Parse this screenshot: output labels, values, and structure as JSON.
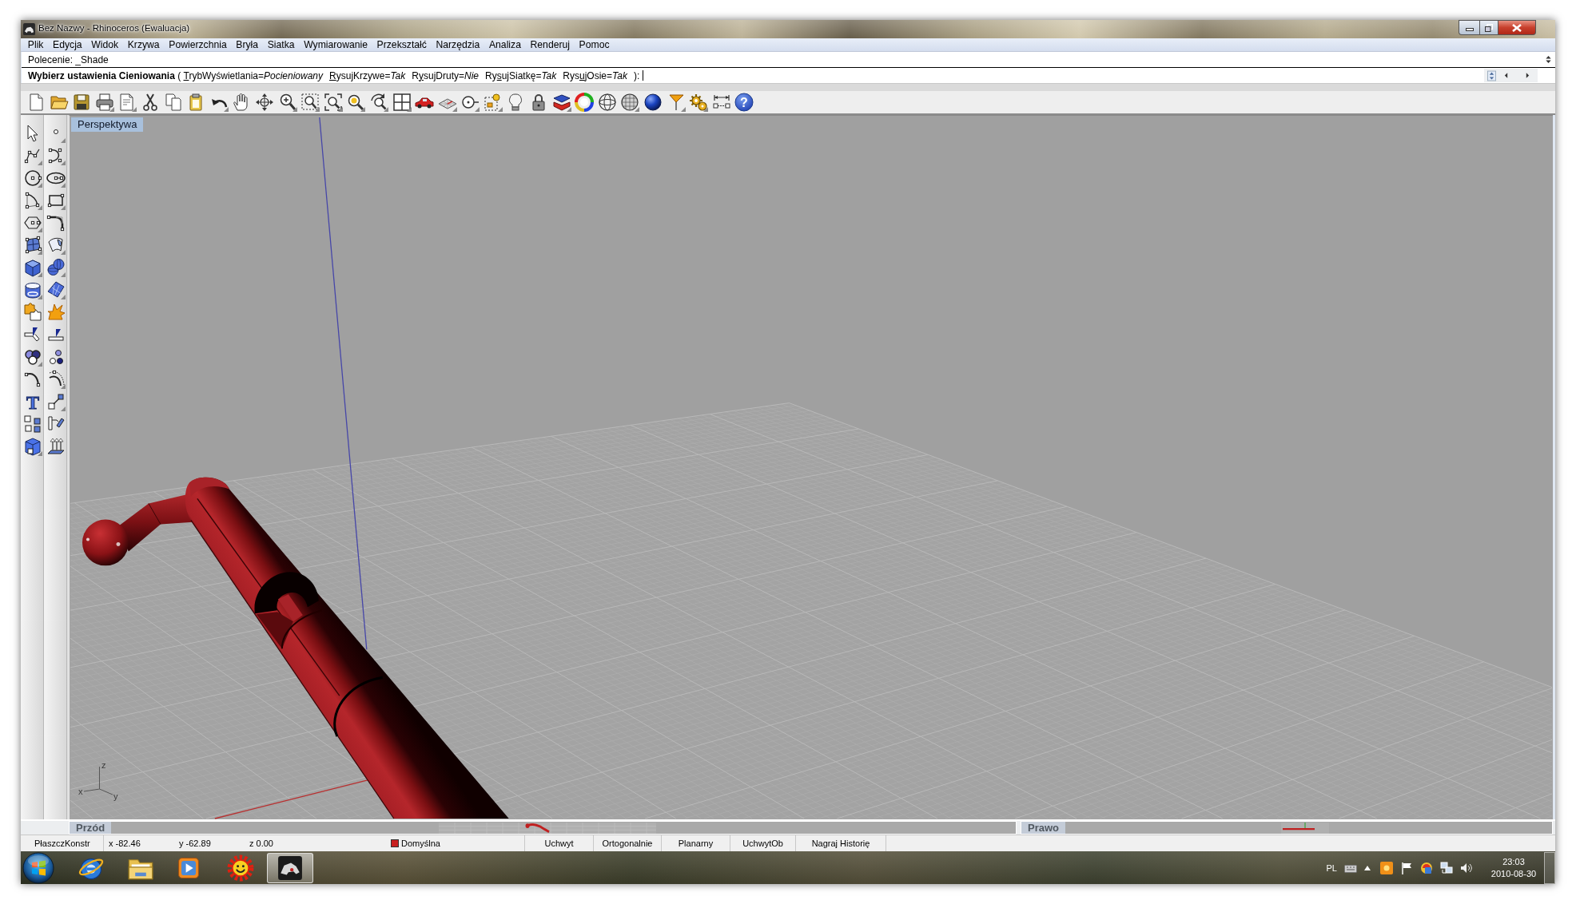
{
  "window": {
    "title": "Bez Nazwy - Rhinoceros (Ewaluacja)"
  },
  "menu": [
    "Plik",
    "Edycja",
    "Widok",
    "Krzywa",
    "Powierzchnia",
    "Bryła",
    "Siatka",
    "Wymiarowanie",
    "Przekształć",
    "Narzędzia",
    "Analiza",
    "Renderuj",
    "Pomoc"
  ],
  "command_history": "Polecenie: _Shade",
  "command_prompt": {
    "prompt": "Wybierz ustawienia Cieniowania",
    "open": "(",
    "options": [
      {
        "hotkey": "T",
        "after": "rybWyświetlania=",
        "value": "Pocieniowany"
      },
      {
        "hotkey": "R",
        "after": "ysujKrzywe=",
        "value": "Tak"
      },
      {
        "before": "R",
        "hotkey": "y",
        "after": "sujDruty=",
        "value": "Nie"
      },
      {
        "before": "Ry",
        "hotkey": "s",
        "after": "ujSiatkę=",
        "value": "Tak"
      },
      {
        "before": "Rys",
        "hotkey": "u",
        "after": "jOsie=",
        "value": "Tak"
      }
    ],
    "close": "):"
  },
  "toolbar": {
    "help_glyph": "?"
  },
  "side_toolbar": {
    "text_tool_glyph": "T"
  },
  "viewport": {
    "title": "Perspektywa",
    "axis_labels": [
      "z",
      "x",
      "y"
    ]
  },
  "viewport_tabs": [
    "Przód",
    "Prawo"
  ],
  "status_bar": {
    "cplane": "PłaszczKonstr",
    "x": "x -82.46",
    "y": "y -62.89",
    "z": "z 0.00",
    "layer": "Domyślna",
    "panes": [
      "Uchwyt",
      "Ortogonalnie",
      "Planarny",
      "UchwytOb",
      "Nagraj Historię"
    ]
  },
  "taskbar": {
    "language": "PL",
    "time": "23:03",
    "date": "2010-08-30"
  }
}
